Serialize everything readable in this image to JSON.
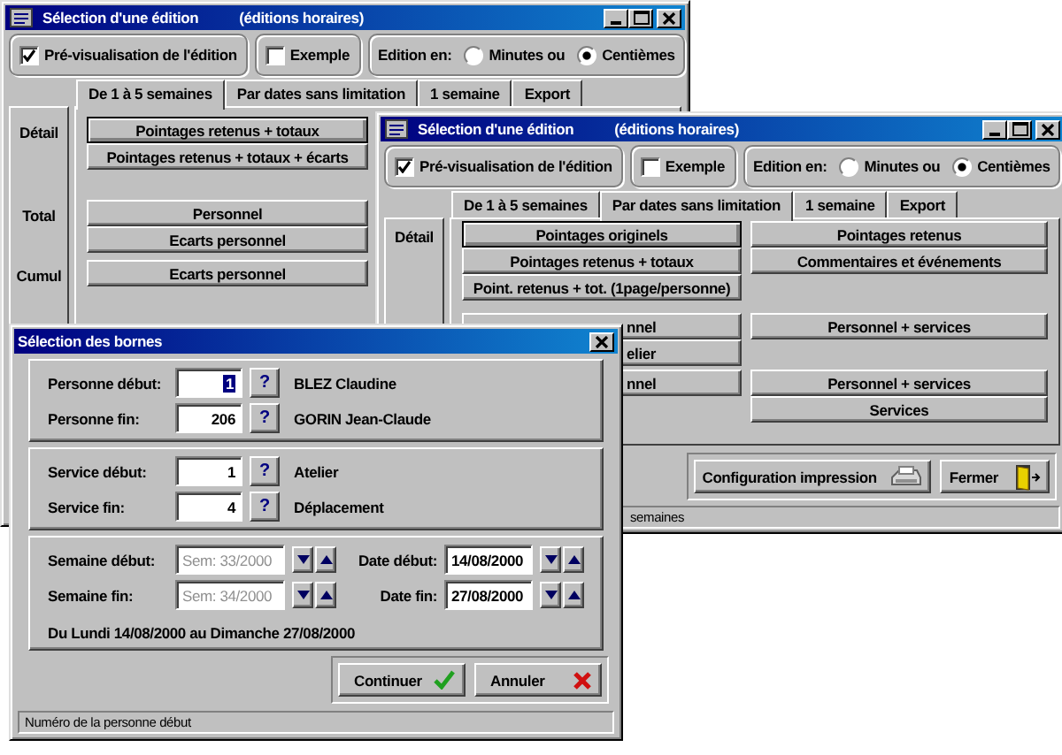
{
  "windows": [
    {
      "title": "Sélection d'une édition",
      "subtitle": "(éditions horaires)",
      "preview": {
        "label": "Pré-visualisation de l'édition",
        "checked": true
      },
      "example": {
        "label": "Exemple",
        "checked": false
      },
      "edition": {
        "label": "Edition en:",
        "options": [
          {
            "label": "Minutes ou",
            "selected": false
          },
          {
            "label": "Centièmes",
            "selected": true
          }
        ]
      },
      "tabs": [
        {
          "label": "De 1 à 5 semaines",
          "selected": true
        },
        {
          "label": "Par dates sans limitation",
          "selected": false
        },
        {
          "label": "1 semaine",
          "selected": false
        },
        {
          "label": "Export",
          "selected": false
        }
      ],
      "sections": [
        {
          "label": "Détail",
          "left": [
            {
              "text": "Pointages retenus + totaux",
              "kind": "full",
              "default": true
            },
            {
              "text": "Pointages retenus + totaux + écarts",
              "kind": "full",
              "default": false
            }
          ]
        },
        {
          "label": "Total",
          "left": [
            {
              "text": "Personnel",
              "kind": "full",
              "default": false
            },
            {
              "text": "Ecarts personnel",
              "kind": "full",
              "default": false
            }
          ]
        },
        {
          "label": "Cumul",
          "left": [
            {
              "text": "Ecarts personnel",
              "kind": "full",
              "default": false
            }
          ]
        }
      ]
    },
    {
      "title": "Sélection d'une édition",
      "subtitle": "(éditions horaires)",
      "preview": {
        "label": "Pré-visualisation de l'édition",
        "checked": true
      },
      "example": {
        "label": "Exemple",
        "checked": false
      },
      "edition": {
        "label": "Edition en:",
        "options": [
          {
            "label": "Minutes ou",
            "selected": false
          },
          {
            "label": "Centièmes",
            "selected": true
          }
        ]
      },
      "tabs": [
        {
          "label": "De 1 à 5 semaines",
          "selected": false
        },
        {
          "label": "Par dates sans limitation",
          "selected": true
        },
        {
          "label": "1 semaine",
          "selected": false
        },
        {
          "label": "Export",
          "selected": false
        }
      ],
      "sections": [
        {
          "label": "Détail",
          "left": [
            {
              "text": "Pointages originels",
              "kind": "full",
              "default": true
            },
            {
              "text": "Pointages retenus + totaux",
              "kind": "full",
              "default": false
            },
            {
              "text": "Point. retenus + tot. (1page/personne)",
              "kind": "full",
              "default": false
            }
          ],
          "right": [
            {
              "text": "Pointages retenus",
              "kind": "full",
              "default": false
            },
            {
              "text": "Commentaires et événements",
              "kind": "full",
              "default": false
            }
          ]
        },
        {
          "left": [
            {
              "text": "nnel",
              "kind": "partial",
              "default": false
            },
            {
              "text": "elier",
              "kind": "partial",
              "default": false
            }
          ],
          "right": [
            {
              "text": "Personnel + services",
              "kind": "full",
              "default": false
            }
          ]
        },
        {
          "left": [
            {
              "text": "nnel",
              "kind": "partial",
              "default": false
            }
          ],
          "right": [
            {
              "text": "Personnel + services",
              "kind": "full",
              "default": false
            },
            {
              "text": "Services",
              "kind": "full",
              "default": false
            }
          ]
        }
      ],
      "footer_buttons": [
        {
          "text": "Configuration impression",
          "kind": "printer"
        },
        {
          "text": "Fermer",
          "kind": "exit"
        }
      ],
      "status": "semaines"
    }
  ],
  "dialog": {
    "title": "Sélection des bornes",
    "persons": [
      {
        "label": "Personne début:",
        "value": "1",
        "selected": true,
        "help": "?",
        "name": "BLEZ Claudine"
      },
      {
        "label": "Personne fin:",
        "value": "206",
        "selected": false,
        "help": "?",
        "name": "GORIN Jean-Claude"
      }
    ],
    "services": [
      {
        "label": "Service début:",
        "value": "1",
        "selected": false,
        "help": "?",
        "name": "Atelier"
      },
      {
        "label": "Service fin:",
        "value": "4",
        "selected": false,
        "help": "?",
        "name": "Déplacement"
      }
    ],
    "period": {
      "rows": [
        {
          "week_label": "Semaine début:",
          "week_value": "Sem: 33/2000",
          "week_disabled": true,
          "date_label": "Date début:",
          "date_value": "14/08/2000"
        },
        {
          "week_label": "Semaine fin:",
          "week_value": "Sem: 34/2000",
          "week_disabled": true,
          "date_label": "Date fin:",
          "date_value": "27/08/2000"
        }
      ],
      "summary": "Du Lundi 14/08/2000 au Dimanche 27/08/2000"
    },
    "buttons": [
      {
        "text": "Continuer",
        "kind": "ok"
      },
      {
        "text": "Annuler",
        "kind": "cancel"
      }
    ],
    "status": "Numéro de la personne début"
  }
}
